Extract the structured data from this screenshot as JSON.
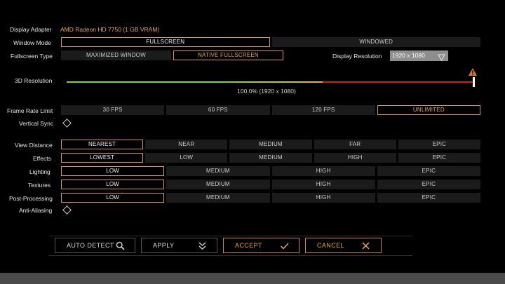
{
  "display_adapter": {
    "label": "Display Adapter",
    "value": "AMD Radeon HD 7750 (1 GB VRAM)"
  },
  "window_mode": {
    "label": "Window Mode",
    "options": [
      "FULLSCREEN",
      "WINDOWED"
    ],
    "selected": "FULLSCREEN"
  },
  "fullscreen_type": {
    "label": "Fullscreen Type",
    "options": [
      "MAXIMIZED WINDOW",
      "NATIVE FULLSCREEN"
    ],
    "selected": "NATIVE FULLSCREEN"
  },
  "display_resolution": {
    "label": "Display Resolution",
    "value": "1920 x 1080"
  },
  "resolution_3d": {
    "label": "3D Resolution",
    "readout": "100.0%  (1920 x 1080)",
    "level": 1.0
  },
  "frame_rate": {
    "label": "Frame Rate Limit",
    "options": [
      "30 FPS",
      "60 FPS",
      "120 FPS",
      "UNLIMITED"
    ],
    "selected": "UNLIMITED"
  },
  "vertical_sync": {
    "label": "Vertical Sync",
    "checked": false
  },
  "view_distance": {
    "label": "View Distance",
    "options": [
      "NEAREST",
      "NEAR",
      "MEDIUM",
      "FAR",
      "EPIC"
    ],
    "selected": "NEAREST"
  },
  "effects": {
    "label": "Effects",
    "options": [
      "LOWEST",
      "LOW",
      "MEDIUM",
      "HIGH",
      "EPIC"
    ],
    "selected": "LOWEST"
  },
  "lighting": {
    "label": "Lighting",
    "options": [
      "LOW",
      "MEDIUM",
      "HIGH",
      "EPIC"
    ],
    "selected": "LOW"
  },
  "textures": {
    "label": "Textures",
    "options": [
      "LOW",
      "MEDIUM",
      "HIGH",
      "EPIC"
    ],
    "selected": "LOW"
  },
  "post_processing": {
    "label": "Post-Processing",
    "options": [
      "LOW",
      "MEDIUM",
      "HIGH",
      "EPIC"
    ],
    "selected": "LOW"
  },
  "anti_aliasing": {
    "label": "Anti-Aliasing",
    "checked": false
  },
  "buttons": {
    "auto_detect": "AUTO DETECT",
    "apply": "APPLY",
    "accept": "ACCEPT",
    "cancel": "CANCEL"
  },
  "icons": {
    "warning": "warning-triangle-icon",
    "dropdown": "triangle-down-icon",
    "search": "magnifier-icon",
    "apply": "double-chevron-down-icon",
    "accept": "checkmark-icon",
    "cancel": "x-icon"
  },
  "colors": {
    "accent": "#d79b4c",
    "green": "#8ccf4a",
    "yellow": "#e0b23a",
    "red": "#cc1f1f",
    "cell": "#1b1b1b"
  }
}
